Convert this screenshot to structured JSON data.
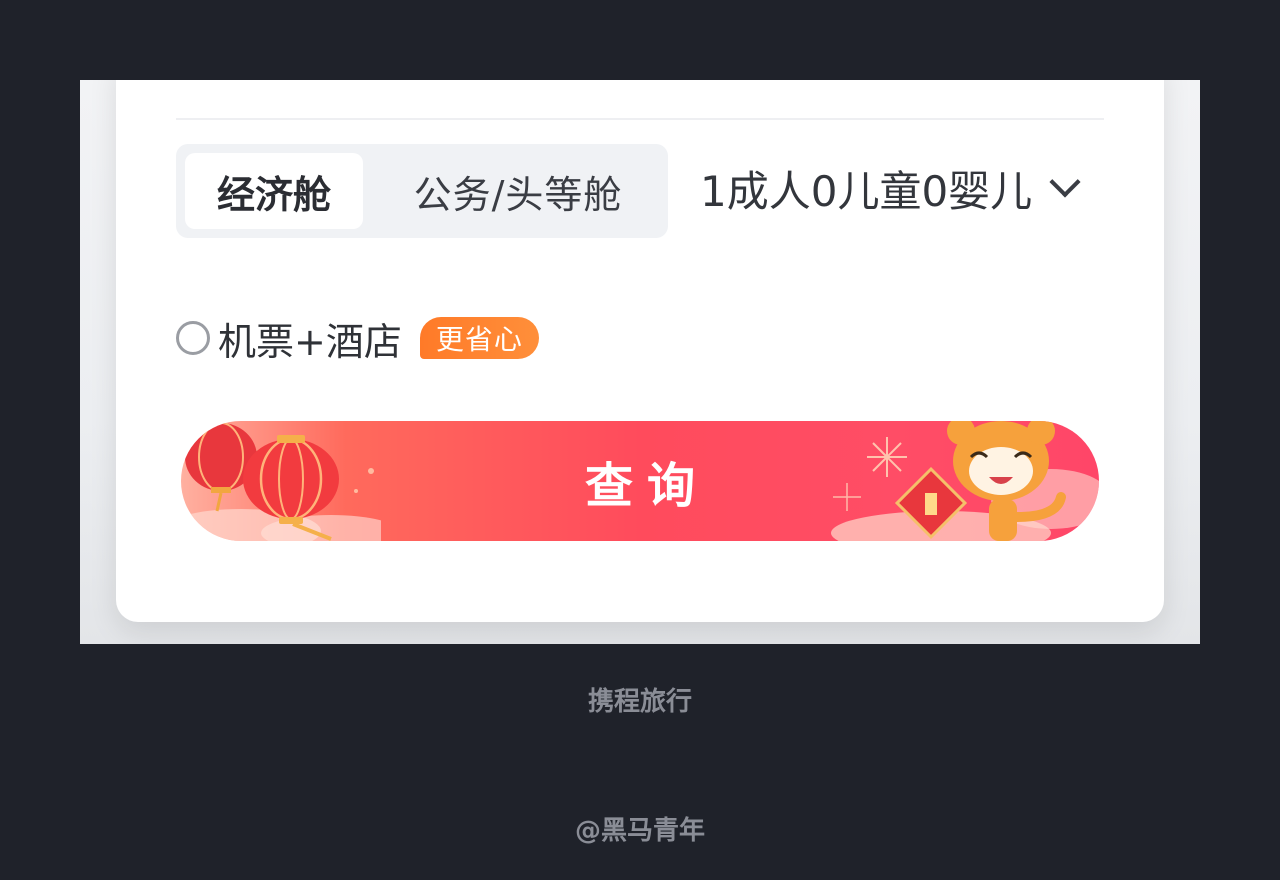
{
  "cabin": {
    "options": [
      "经济舱",
      "公务/头等舱"
    ],
    "selected": "经济舱"
  },
  "passengers": {
    "summary": "1成人0儿童0婴儿",
    "icon": "chevron-down-icon"
  },
  "bundle": {
    "label": "机票+酒店",
    "badge": "更省心",
    "checked": false
  },
  "search_button": {
    "label": "查询"
  },
  "captions": {
    "app_name": "携程旅行",
    "credit": "@黑马青年"
  },
  "colors": {
    "page_background": "#1f222a",
    "card": "#ffffff",
    "badge": "#ff7a28",
    "search_button": "#ff4b5c",
    "caption": "#8a8d96"
  }
}
